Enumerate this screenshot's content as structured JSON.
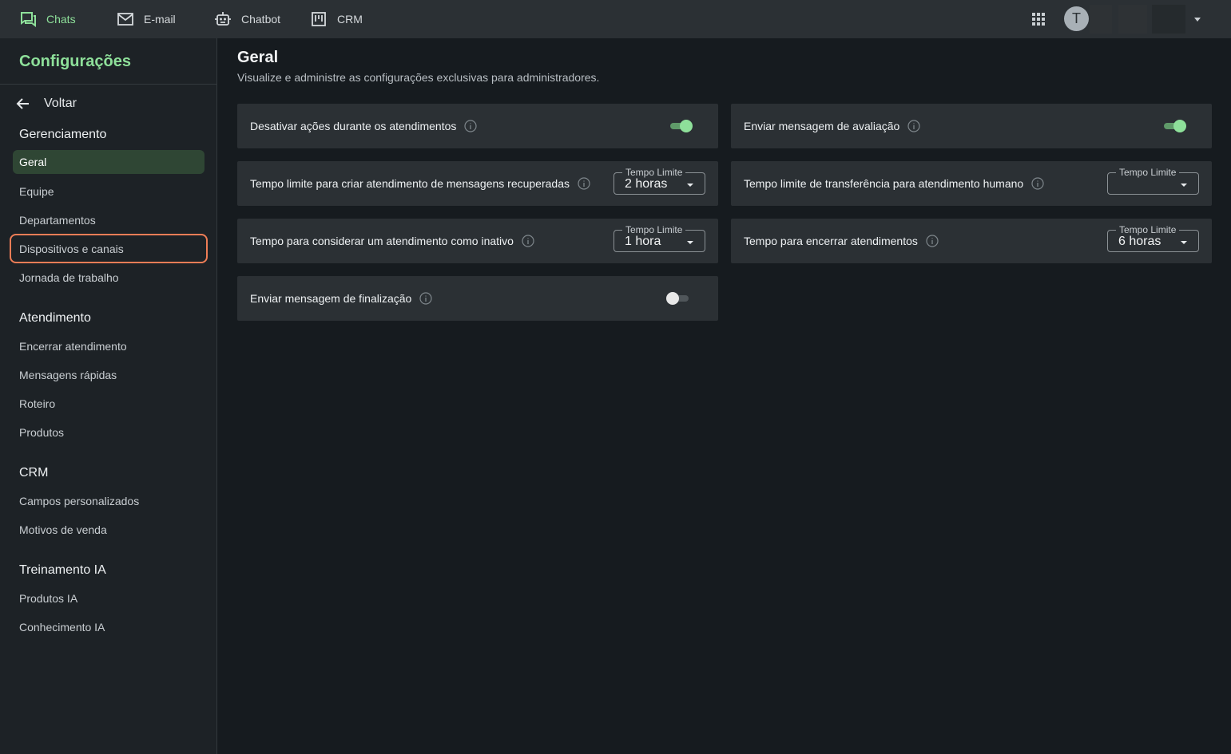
{
  "topnav": {
    "items": [
      {
        "label": "Chats",
        "icon": "chat-icon",
        "active": true
      },
      {
        "label": "E-mail",
        "icon": "mail-icon"
      },
      {
        "label": "Chatbot",
        "icon": "robot-icon"
      },
      {
        "label": "CRM",
        "icon": "kanban-icon"
      }
    ],
    "apps_icon": "grid-apps-icon",
    "avatar_initial": "T",
    "user_menu_icon": "caret-down-icon"
  },
  "sidebar": {
    "title": "Configurações",
    "back_label": "Voltar",
    "sections": [
      {
        "title": "Gerenciamento",
        "items": [
          "Geral",
          "Equipe",
          "Departamentos",
          "Dispositivos e canais",
          "Jornada de trabalho"
        ]
      },
      {
        "title": "Atendimento",
        "items": [
          "Encerrar atendimento",
          "Mensagens rápidas",
          "Roteiro",
          "Produtos"
        ]
      },
      {
        "title": "CRM",
        "items": [
          "Campos personalizados",
          "Motivos de venda"
        ]
      },
      {
        "title": "Treinamento IA",
        "items": [
          "Produtos IA",
          "Conhecimento IA"
        ]
      }
    ],
    "active_item": "Geral",
    "highlighted_item": "Dispositivos e canais"
  },
  "main": {
    "title": "Geral",
    "subtitle": "Visualize e administre as configurações exclusivas para administradores.",
    "settings": [
      {
        "label": "Desativar ações durante os atendimentos",
        "control": "toggle",
        "on": true
      },
      {
        "label": "Enviar mensagem de avaliação",
        "control": "toggle",
        "on": true
      },
      {
        "label": "Tempo limite para criar atendimento de mensagens recuperadas",
        "control": "select",
        "legend": "Tempo Limite",
        "value": "2 horas"
      },
      {
        "label": "Tempo limite de transferência para atendimento humano",
        "control": "select",
        "legend": "Tempo Limite",
        "value": ""
      },
      {
        "label": "Tempo para considerar um atendimento como inativo",
        "control": "select",
        "legend": "Tempo Limite",
        "value": "1 hora"
      },
      {
        "label": "Tempo para encerrar atendimentos",
        "control": "select",
        "legend": "Tempo Limite",
        "value": "6 horas"
      },
      {
        "label": "Enviar mensagem de finalização",
        "control": "toggle",
        "on": false
      }
    ]
  },
  "colors": {
    "accent": "#8ee09a",
    "highlight_border": "#ee7d56",
    "card_bg": "#2b3034",
    "page_bg": "#161b1f"
  }
}
